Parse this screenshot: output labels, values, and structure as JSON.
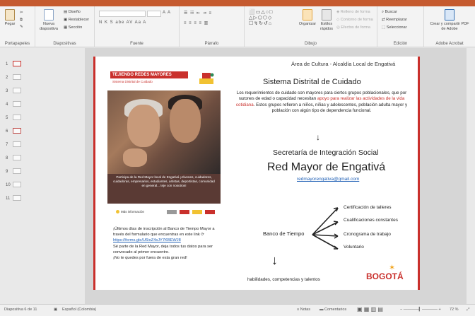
{
  "ribbon": {
    "pegar": "Pegar",
    "portapapeles": "Portapapeles",
    "nueva_diapositiva": "Nueva diapositiva",
    "diseno": "Diseño",
    "restablecer": "Restablecer",
    "seccion": "Sección",
    "diapositivas": "Diapositivas",
    "fuente": "Fuente",
    "parrafo": "Párrafo",
    "organizar": "Organizar",
    "estilos": "Estilos rápidos",
    "relleno": "Relleno de forma",
    "contorno": "Contorno de forma",
    "efectos": "Efectos de forma",
    "dibujo": "Dibujo",
    "buscar": "Buscar",
    "reemplazar": "Reemplazar",
    "seleccionar": "Seleccionar",
    "edicion": "Edición",
    "crear_pdf": "Crear y compartir PDF de Adobe",
    "adobe": "Adobe Acrobat"
  },
  "pane": {
    "slides": [
      "1",
      "2",
      "3",
      "4",
      "5",
      "6",
      "7",
      "8",
      "9",
      "10",
      "11"
    ],
    "selected": "6"
  },
  "slide": {
    "area_title": "Área de Cultura - Alcaldía Local de Engativá",
    "sd_title": "Sistema Distrital de Cuidado",
    "sd_para_1": "Los requerimientos de cuidado son mayores para ciertos grupos poblacionales, que por razones de edad o capacidad necesitan ",
    "sd_para_red": "apoyo para realizar las actividades de la vida cotidiana",
    "sd_para_2": ". Estos grupos refieren a niños, niñas y adolescentes, población adulta mayor y población con algún tipo de dependencia funcional.",
    "sec_title": "Secretaría de Integración Social",
    "red_mayor": "Red Mayor de Engativá",
    "email": "redmayorengativa@gmail.com",
    "banco": "Banco de Tiempo",
    "branches": [
      "Certificación de talleres",
      "Cualificaciones constantes",
      "Cronograma de trabajo",
      "Voluntario"
    ],
    "habilidades": "habilidades, competencias y talentos",
    "left_text_1": "¡Últimos días de inscripción al Banco de Tiempo Mayor a través del formulario que encuentras en este link",
    "left_link": "https://forms.gle/U6ioZ4xJY7KBEWJ8",
    "left_text_2": "Sé parte de la Red Mayor, deja todos tus datos para ser convocado al primer encuentro.",
    "left_text_3": "¡No te quedes por fuera de esta gran red!",
    "bogota": "BOGOTÁ",
    "poster": {
      "title": "TEJIENDO REDES MAYORES",
      "subtitle": "Sistema Distrital de Cuidado",
      "text": "Participa de la Red Mayor local de Engativá ¡Jóvenes, cuidadores, cuidadoras, empresarios, estudiantes, artistas, deportistas, comunidad en general... teje con nosotros!",
      "info": "Más información"
    }
  },
  "status": {
    "slide_of": "Diapositiva 6 de 11",
    "lang": "Español (Colombia)",
    "notas": "Notas",
    "comentarios": "Comentarios",
    "zoom": "72 %"
  },
  "colors": {
    "accent": "#c55a2f",
    "brand_red": "#c9302c",
    "link": "#1f5fb5"
  }
}
